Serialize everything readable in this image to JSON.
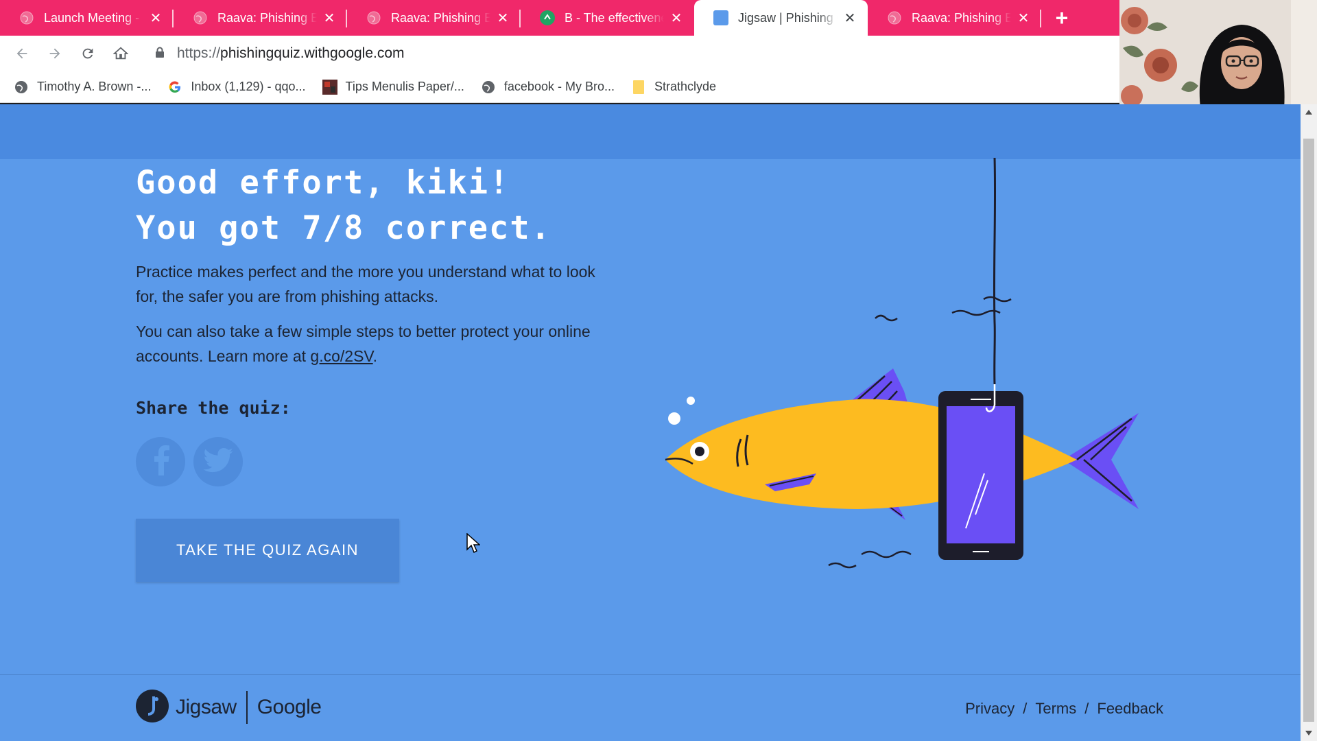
{
  "browser": {
    "tabs": [
      {
        "title": "Launch Meeting - Z",
        "icon": "globe-icon",
        "active": false
      },
      {
        "title": "Raava: Phishing Em",
        "icon": "globe-icon",
        "active": false
      },
      {
        "title": "Raava: Phishing Em",
        "icon": "globe-icon",
        "active": false
      },
      {
        "title": "B - The effectivenes",
        "icon": "green-recycle-icon",
        "active": false
      },
      {
        "title": "Jigsaw | Phishing Q",
        "icon": "blue-square-icon",
        "active": true
      },
      {
        "title": "Raava: Phishing Em",
        "icon": "globe-icon",
        "active": false
      }
    ],
    "new_tab_label": "+",
    "url_scheme": "https://",
    "url_host": "phishingquiz.withgoogle.com",
    "bookmarks": [
      {
        "label": "Timothy A. Brown -...",
        "icon": "globe-icon"
      },
      {
        "label": "Inbox (1,129) - qqo...",
        "icon": "google-g-icon"
      },
      {
        "label": "Tips Menulis Paper/...",
        "icon": "thumbnail-icon"
      },
      {
        "label": "facebook - My Bro...",
        "icon": "globe-icon"
      },
      {
        "label": "Strathclyde",
        "icon": "folder-icon"
      }
    ],
    "colors": {
      "tabstrip": "#f0286a",
      "page_bg": "#5b9aea",
      "header_bg": "#4a8ae0"
    }
  },
  "result": {
    "heading_line1": "Good effort, kiki!",
    "heading_line2": "You got 7/8 correct.",
    "para1": "Practice makes perfect and the more you understand what to look for, the safer you are from phishing attacks.",
    "para2_prefix": "You can also take a few simple steps to better protect your online accounts. Learn more at ",
    "para2_link": "g.co/2SV",
    "para2_suffix": ".",
    "share_label": "Share the quiz:",
    "retake_button": "TAKE THE QUIZ AGAIN"
  },
  "footer": {
    "brand_jigsaw": "Jigsaw",
    "brand_google": "Google",
    "links": [
      "Privacy",
      "Terms",
      "Feedback"
    ],
    "separator": "/"
  }
}
